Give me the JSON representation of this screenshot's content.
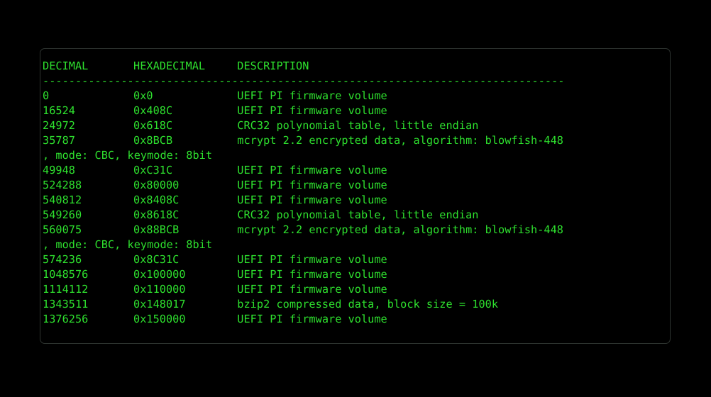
{
  "terminal": {
    "palette": {
      "background": "#000000",
      "foreground": "#2ee02e",
      "border": "#2e3430"
    },
    "headers": {
      "decimal": "DECIMAL",
      "hexadecimal": "HEXADECIMAL",
      "description": "DESCRIPTION"
    },
    "separator": "--------------------------------------------------------------------------------",
    "entries": [
      {
        "decimal": "0",
        "hexadecimal": "0x0",
        "description": "UEFI PI firmware volume"
      },
      {
        "decimal": "16524",
        "hexadecimal": "0x408C",
        "description": "UEFI PI firmware volume"
      },
      {
        "decimal": "24972",
        "hexadecimal": "0x618C",
        "description": "CRC32 polynomial table, little endian"
      },
      {
        "decimal": "35787",
        "hexadecimal": "0x8BCB",
        "description": "mcrypt 2.2 encrypted data, algorithm: blowfish-448",
        "continuation": ", mode: CBC, keymode: 8bit"
      },
      {
        "decimal": "49948",
        "hexadecimal": "0xC31C",
        "description": "UEFI PI firmware volume"
      },
      {
        "decimal": "524288",
        "hexadecimal": "0x80000",
        "description": "UEFI PI firmware volume"
      },
      {
        "decimal": "540812",
        "hexadecimal": "0x8408C",
        "description": "UEFI PI firmware volume"
      },
      {
        "decimal": "549260",
        "hexadecimal": "0x8618C",
        "description": "CRC32 polynomial table, little endian"
      },
      {
        "decimal": "560075",
        "hexadecimal": "0x88BCB",
        "description": "mcrypt 2.2 encrypted data, algorithm: blowfish-448",
        "continuation": ", mode: CBC, keymode: 8bit"
      },
      {
        "decimal": "574236",
        "hexadecimal": "0x8C31C",
        "description": "UEFI PI firmware volume"
      },
      {
        "decimal": "1048576",
        "hexadecimal": "0x100000",
        "description": "UEFI PI firmware volume"
      },
      {
        "decimal": "1114112",
        "hexadecimal": "0x110000",
        "description": "UEFI PI firmware volume"
      },
      {
        "decimal": "1343511",
        "hexadecimal": "0x148017",
        "description": "bzip2 compressed data, block size = 100k"
      },
      {
        "decimal": "1376256",
        "hexadecimal": "0x150000",
        "description": "UEFI PI firmware volume"
      }
    ]
  }
}
